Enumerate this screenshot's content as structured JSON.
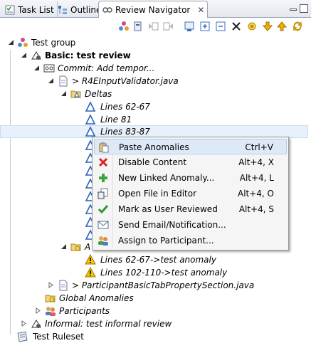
{
  "tabs": [
    {
      "label": "Task List",
      "icon": "task-list-icon"
    },
    {
      "label": "Outline",
      "icon": "outline-icon"
    },
    {
      "label": "Review Navigator",
      "icon": "review-navigator-icon",
      "active": true
    }
  ],
  "tab_close": "✕",
  "toolbar": [
    "reviews-icon",
    "import-icon",
    "navigate-back-icon",
    "navigate-forward-icon",
    "export-icon",
    "expand-all-icon",
    "collapse-all-icon",
    "filter-icon",
    "anomaly-icon",
    "previous-icon",
    "next-icon",
    "sync-icon"
  ],
  "tree": {
    "test_group": "Test group",
    "basic_review": "Basic: test review",
    "commit": "Commit: Add tempor...",
    "file1": "> R4EInputValidator.java",
    "deltas": "Deltas",
    "delta_rows": [
      "Lines 62-67",
      "Line 81",
      "Lines 83-87"
    ],
    "anomalies_folder": "A",
    "anomaly_rows": [
      "Lines 62-67->test anomaly",
      "Lines 102-110->test anomaly"
    ],
    "file2": "> ParticipantBasicTabPropertySection.java",
    "global_anomalies": "Global Anomalies",
    "participants": "Participants",
    "informal_review": "Informal: test informal review",
    "test_ruleset": "Test Ruleset"
  },
  "context_menu": [
    {
      "label": "Paste Anomalies",
      "shortcut": "Ctrl+V",
      "icon": "paste-icon",
      "highlighted": true
    },
    {
      "label": "Disable Content",
      "shortcut": "Alt+4, X",
      "icon": "disable-icon"
    },
    {
      "label": "New Linked Anomaly...",
      "shortcut": "Alt+4, L",
      "icon": "add-icon"
    },
    {
      "label": "Open File in Editor",
      "shortcut": "Alt+4, O",
      "icon": "open-file-icon"
    },
    {
      "label": "Mark as User Reviewed",
      "shortcut": "Alt+4, S",
      "icon": "checkmark-icon"
    },
    {
      "label": "Send Email/Notification...",
      "shortcut": "",
      "icon": "email-icon"
    },
    {
      "label": "Assign to Participant...",
      "shortcut": "",
      "icon": "assign-participant-icon"
    }
  ],
  "colors": {
    "selection": "#e8f1fb",
    "menu_highlight": "#dde9f6",
    "delta_blue": "#2b62b8",
    "warning_yellow": "#f5c400"
  }
}
